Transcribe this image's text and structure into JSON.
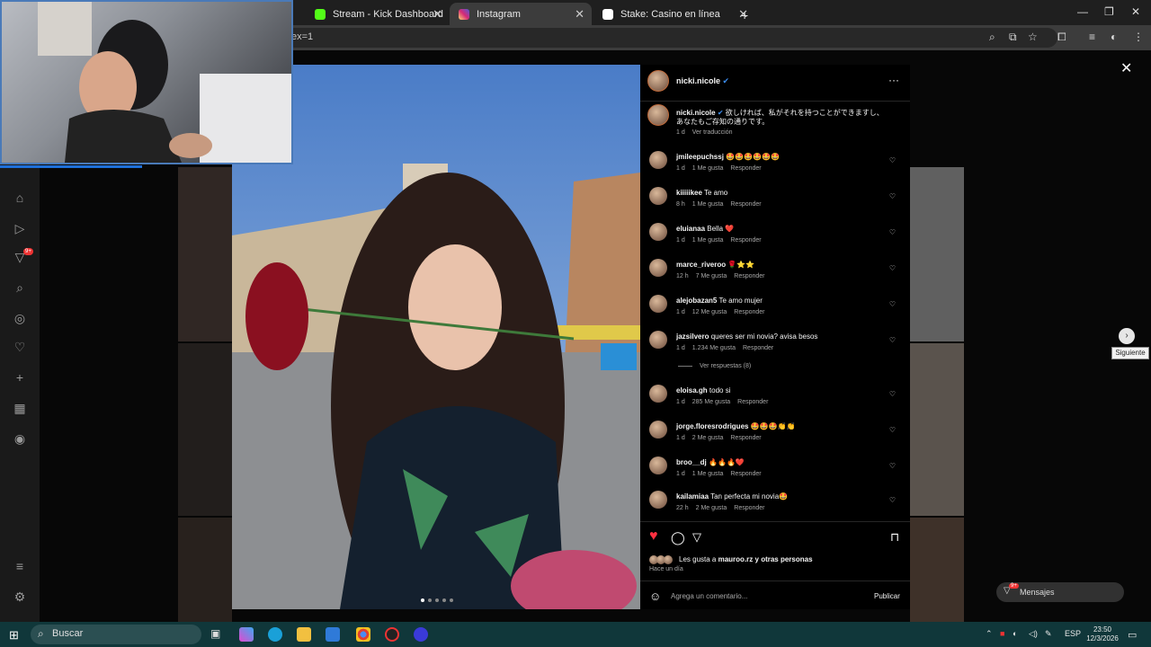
{
  "browser": {
    "tabs": [
      {
        "label": "Stream - Kick Dashboard",
        "icon": "kick-icon",
        "color": "#53fc18",
        "active": false
      },
      {
        "label": "Instagram",
        "icon": "instagram-icon",
        "color": "#d6249f",
        "active": true
      },
      {
        "label": "Stake: Casino en línea y Apuest",
        "icon": "stake-icon",
        "color": "#1a2c38",
        "active": false
      }
    ],
    "new_tab": "+",
    "address_fragment": "ex=1",
    "window_controls": [
      "—",
      "❐",
      "✕"
    ]
  },
  "kick_sidebar": {
    "icons": [
      "home-icon",
      "video-icon",
      "notifications-icon",
      "search-icon",
      "explore-icon",
      "heart-icon",
      "add-icon",
      "analytics-icon",
      "profile-icon",
      "menu-icon",
      "settings-icon"
    ],
    "badge": "9+"
  },
  "post": {
    "username": "nicki.nicole",
    "verified": true,
    "more": "···",
    "caption": {
      "username": "nicki.nicole",
      "line1": "欲しければ、私がそれを持つことができますし、",
      "line2": "あなたもご存知の通りです。",
      "time": "1 d",
      "translate": "Ver traducción"
    },
    "comments": [
      {
        "user": "jmileepuchssj",
        "text": "🤩🤩🤩🤩🤩🤩",
        "time": "1 d",
        "likes": "1 Me gusta",
        "reply": "Responder"
      },
      {
        "user": "kiiiiikee",
        "text": "Te amo",
        "time": "8 h",
        "likes": "1 Me gusta",
        "reply": "Responder"
      },
      {
        "user": "eluianaa",
        "text": "Bella ❤️",
        "time": "1 d",
        "likes": "1 Me gusta",
        "reply": "Responder"
      },
      {
        "user": "marce_riveroo",
        "text": "🌹⭐⭐",
        "time": "12 h",
        "likes": "7 Me gusta",
        "reply": "Responder"
      },
      {
        "user": "alejobazan5",
        "text": "Te amo mujer",
        "time": "1 d",
        "likes": "12 Me gusta",
        "reply": "Responder"
      },
      {
        "user": "jazsilvero",
        "text": "queres ser mi novia? avisa besos",
        "time": "1 d",
        "likes": "1.234 Me gusta",
        "reply": "Responder"
      },
      {
        "user": "eloisa.gh",
        "text": "todo si",
        "time": "1 d",
        "likes": "285 Me gusta",
        "reply": "Responder"
      },
      {
        "user": "jorge.floresrodrigues",
        "text": "🤩🤩🤩👏👏",
        "time": "1 d",
        "likes": "2 Me gusta",
        "reply": "Responder"
      },
      {
        "user": "broo__dj",
        "text": "🔥🔥🔥❤️",
        "time": "1 d",
        "likes": "1 Me gusta",
        "reply": "Responder"
      },
      {
        "user": "kailamiaa",
        "text": "Tan perfecta mi novia🤩",
        "time": "22 h",
        "likes": "2 Me gusta",
        "reply": "Responder"
      }
    ],
    "view_replies": "Ver respuestas (8)",
    "liked_by_prefix": "Les gusta a",
    "liked_by_user": "mauroo.rz",
    "liked_by_suffix": "y otras personas",
    "post_time": "Hace un día",
    "comment_placeholder": "Agrega un comentario...",
    "publish": "Publicar"
  },
  "overlay": {
    "close": "✕",
    "next_tooltip": "Siguiente",
    "messages": "Mensajes",
    "messages_badge": "9+"
  },
  "taskbar": {
    "search": "Buscar",
    "lang": "ESP",
    "time": "23:50",
    "date": "12/3/2026"
  }
}
